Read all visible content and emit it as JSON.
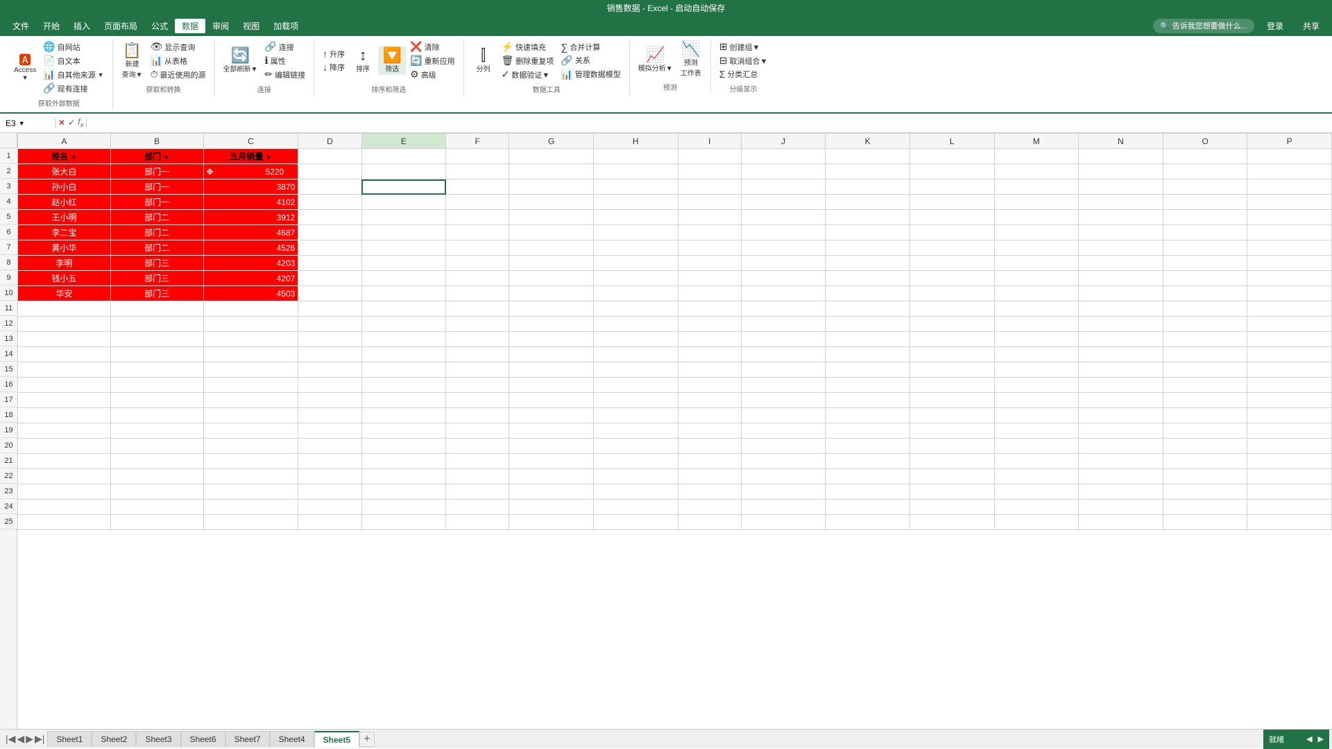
{
  "title": "销售数据 - Excel - 启动自动保存",
  "menu": {
    "items": [
      "文件",
      "开始",
      "插入",
      "页面布局",
      "公式",
      "数据",
      "审阅",
      "视图",
      "加载项"
    ],
    "active": "数据",
    "search_placeholder": "告诉我您想要做什么...",
    "right_buttons": [
      "登录",
      "共享"
    ]
  },
  "ribbon": {
    "groups": [
      {
        "name": "获取外部数据",
        "buttons": [
          {
            "label": "Access",
            "icon": "🅰",
            "sub": true
          },
          {
            "label": "自网站",
            "icon": "🌐",
            "sub": false
          },
          {
            "label": "自文本",
            "icon": "📄",
            "sub": false
          },
          {
            "label": "自其他来源",
            "icon": "📊",
            "sub": true
          },
          {
            "label": "现有连接",
            "icon": "🔗",
            "sub": false
          }
        ]
      },
      {
        "name": "获取和转换",
        "buttons": [
          {
            "label": "新建查询",
            "icon": "📋",
            "sub": true
          },
          {
            "label": "显示查询",
            "icon": "👁"
          },
          {
            "label": "从表格",
            "icon": "📊"
          },
          {
            "label": "最近使用的源",
            "icon": "⏱"
          }
        ]
      },
      {
        "name": "连接",
        "buttons": [
          {
            "label": "连接",
            "icon": "🔗"
          },
          {
            "label": "属性",
            "icon": "ℹ"
          },
          {
            "label": "编辑链接",
            "icon": "✏"
          },
          {
            "label": "全部刷新",
            "icon": "🔄",
            "sub": true
          }
        ]
      },
      {
        "name": "排序和筛选",
        "buttons": [
          {
            "label": "升序",
            "icon": "↑"
          },
          {
            "label": "降序",
            "icon": "↓"
          },
          {
            "label": "排序",
            "icon": "↕"
          },
          {
            "label": "筛选",
            "icon": "🔽",
            "active": true
          },
          {
            "label": "清除",
            "icon": "❌"
          },
          {
            "label": "重新应用",
            "icon": "🔄"
          },
          {
            "label": "高级",
            "icon": "⚙"
          }
        ]
      },
      {
        "name": "数据工具",
        "buttons": [
          {
            "label": "分列",
            "icon": "⫿"
          },
          {
            "label": "快速填充",
            "icon": "⚡"
          },
          {
            "label": "删除重复项",
            "icon": "🗑"
          },
          {
            "label": "数据验证",
            "icon": "✓",
            "sub": true
          },
          {
            "label": "合并计算",
            "icon": "∑"
          },
          {
            "label": "关系",
            "icon": "🔗"
          },
          {
            "label": "管理数据模型",
            "icon": "📊"
          }
        ]
      },
      {
        "name": "预测",
        "buttons": [
          {
            "label": "模拟分析",
            "icon": "📈",
            "sub": true
          },
          {
            "label": "预测工作表",
            "icon": "📉"
          }
        ]
      },
      {
        "name": "分级显示",
        "buttons": [
          {
            "label": "创建组",
            "icon": "⊞",
            "sub": true
          },
          {
            "label": "取消组合",
            "icon": "⊟",
            "sub": true
          },
          {
            "label": "分类汇总",
            "icon": "Σ"
          }
        ]
      }
    ]
  },
  "formula_bar": {
    "cell_ref": "E3",
    "formula": ""
  },
  "columns": {
    "headers": [
      "A",
      "B",
      "C",
      "D",
      "E",
      "F",
      "G",
      "H",
      "I",
      "J",
      "K",
      "L",
      "M",
      "N",
      "O",
      "P"
    ],
    "widths": [
      88,
      88,
      90,
      60,
      80,
      60,
      80,
      80,
      60,
      80,
      80,
      80,
      80,
      80,
      80,
      80
    ]
  },
  "rows": {
    "count": 25,
    "data_rows": [
      {
        "row": 1,
        "cells": [
          {
            "col": "A",
            "value": "姓名",
            "style": "header-red",
            "has_dropdown": true
          },
          {
            "col": "B",
            "value": "部门",
            "style": "header-red",
            "has_dropdown": true
          },
          {
            "col": "C",
            "value": "五月销量",
            "style": "header-red",
            "has_dropdown": true
          }
        ]
      },
      {
        "row": 2,
        "cells": [
          {
            "col": "A",
            "value": "张大白",
            "style": "data-red"
          },
          {
            "col": "B",
            "value": "部门一",
            "style": "data-red"
          },
          {
            "col": "C",
            "value": "5220",
            "style": "data-red num-cell",
            "has_move_icon": true
          }
        ]
      },
      {
        "row": 3,
        "cells": [
          {
            "col": "A",
            "value": "孙小白",
            "style": "data-red"
          },
          {
            "col": "B",
            "value": "部门一",
            "style": "data-red"
          },
          {
            "col": "C",
            "value": "3870",
            "style": "data-red num-cell"
          },
          {
            "col": "E",
            "value": "",
            "style": "selected-cell"
          }
        ]
      },
      {
        "row": 4,
        "cells": [
          {
            "col": "A",
            "value": "赵小红",
            "style": "data-red"
          },
          {
            "col": "B",
            "value": "部门一",
            "style": "data-red"
          },
          {
            "col": "C",
            "value": "4102",
            "style": "data-red num-cell"
          }
        ]
      },
      {
        "row": 5,
        "cells": [
          {
            "col": "A",
            "value": "王小明",
            "style": "data-red"
          },
          {
            "col": "B",
            "value": "部门二",
            "style": "data-red"
          },
          {
            "col": "C",
            "value": "3912",
            "style": "data-red num-cell"
          }
        ]
      },
      {
        "row": 6,
        "cells": [
          {
            "col": "A",
            "value": "李二宝",
            "style": "data-red"
          },
          {
            "col": "B",
            "value": "部门二",
            "style": "data-red"
          },
          {
            "col": "C",
            "value": "4687",
            "style": "data-red num-cell"
          }
        ]
      },
      {
        "row": 7,
        "cells": [
          {
            "col": "A",
            "value": "黄小华",
            "style": "data-red"
          },
          {
            "col": "B",
            "value": "部门二",
            "style": "data-red"
          },
          {
            "col": "C",
            "value": "4526",
            "style": "data-red num-cell"
          }
        ]
      },
      {
        "row": 8,
        "cells": [
          {
            "col": "A",
            "value": "李明",
            "style": "data-red"
          },
          {
            "col": "B",
            "value": "部门三",
            "style": "data-red"
          },
          {
            "col": "C",
            "value": "4203",
            "style": "data-red num-cell"
          }
        ]
      },
      {
        "row": 9,
        "cells": [
          {
            "col": "A",
            "value": "钱小五",
            "style": "data-red"
          },
          {
            "col": "B",
            "value": "部门三",
            "style": "data-red"
          },
          {
            "col": "C",
            "value": "4207",
            "style": "data-red num-cell"
          }
        ]
      },
      {
        "row": 10,
        "cells": [
          {
            "col": "A",
            "value": "华安",
            "style": "data-red"
          },
          {
            "col": "B",
            "value": "部门三",
            "style": "data-red"
          },
          {
            "col": "C",
            "value": "4503",
            "style": "data-red num-cell"
          }
        ]
      }
    ]
  },
  "sheet_tabs": {
    "tabs": [
      "Sheet1",
      "Sheet2",
      "Sheet3",
      "Sheet6",
      "Sheet7",
      "Sheet4",
      "Sheet5"
    ],
    "active": "Sheet5"
  },
  "status_bar": {
    "left": "就绪",
    "right": ""
  }
}
